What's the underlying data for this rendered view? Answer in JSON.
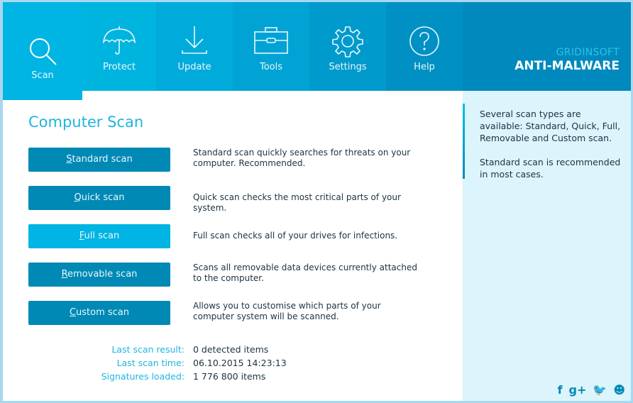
{
  "nav": {
    "tabs": [
      {
        "id": "scan",
        "label": "Scan",
        "icon": "search-icon",
        "active": true,
        "color": "#00b4e3"
      },
      {
        "id": "protect",
        "label": "Protect",
        "icon": "umbrella-icon",
        "active": false,
        "color": "#00b4e0"
      },
      {
        "id": "update",
        "label": "Update",
        "icon": "download-icon",
        "active": false,
        "color": "#00abdb"
      },
      {
        "id": "tools",
        "label": "Tools",
        "icon": "toolbox-icon",
        "active": false,
        "color": "#00a3d4"
      },
      {
        "id": "settings",
        "label": "Settings",
        "icon": "gear-icon",
        "active": false,
        "color": "#009acc"
      },
      {
        "id": "help",
        "label": "Help",
        "icon": "help-circle-icon",
        "active": false,
        "color": "#0090c4"
      }
    ]
  },
  "brand": {
    "sub": "GRIDINSOFT",
    "main": "ANTI-MALWARE"
  },
  "main": {
    "title": "Computer Scan",
    "scans": [
      {
        "mnemonic": "S",
        "rest": "tandard scan",
        "description": "Standard scan quickly searches for threats on your computer. Recommended.",
        "highlighted": false
      },
      {
        "mnemonic": "Q",
        "rest": "uick scan",
        "description": "Quick scan checks the most critical parts of your system.",
        "highlighted": false
      },
      {
        "mnemonic": "F",
        "rest": "ull scan",
        "description": "Full scan checks all of your drives for infections.",
        "highlighted": true
      },
      {
        "mnemonic": "R",
        "rest": "emovable scan",
        "description": "Scans all removable data devices currently attached to the computer.",
        "highlighted": false
      },
      {
        "mnemonic": "C",
        "rest": "ustom scan",
        "description": "Allows you to customise which parts of your computer system will be scanned.",
        "highlighted": false
      }
    ],
    "stats": [
      {
        "label": "Last scan result:",
        "value": "0 detected items"
      },
      {
        "label": "Last scan time:",
        "value": "06.10.2015 14:23:13"
      },
      {
        "label": "Signatures loaded:",
        "value": "1 776 800 items"
      }
    ]
  },
  "sidebar": {
    "paragraphs": [
      "Several scan types are available: Standard, Quick, Full, Removable and Custom scan.",
      "Standard scan is recommended in most cases."
    ],
    "social": [
      {
        "name": "facebook-icon",
        "glyph": "f"
      },
      {
        "name": "google-plus-icon",
        "glyph": "g+"
      },
      {
        "name": "twitter-icon",
        "glyph": "🐦"
      },
      {
        "name": "smiley-icon",
        "glyph": "☻"
      }
    ]
  }
}
